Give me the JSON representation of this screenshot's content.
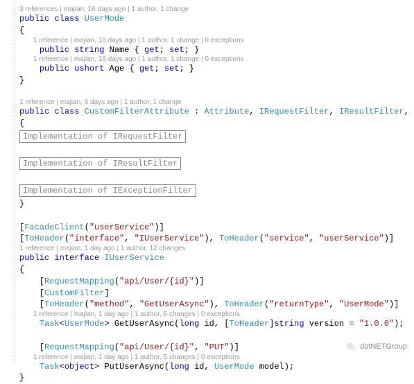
{
  "codelens": {
    "userMode": "3 references | majian, 16 days ago | 1 author, 1 change",
    "name": "1 reference | majian, 16 days ago | 1 author, 1 change | 0 exceptions",
    "age": "1 reference | majian, 16 days ago | 1 author, 1 change | 0 exceptions",
    "customFilter": "1 reference | majian, 6 days ago | 1 author, 1 change",
    "iuserService": "1 reference | majian, 1 day ago | 1 author, 12 changes",
    "getUser": "1 reference | majian, 1 day ago | 1 author, 6 changes | 0 exceptions",
    "putUser": "1 reference | majian, 1 day ago | 1 author, 5 changes | 0 exceptions"
  },
  "code": {
    "public": "public",
    "class": "class",
    "string_kw": "string",
    "ushort": "ushort",
    "interface": "interface",
    "long": "long",
    "get": "get",
    "set": "set",
    "object": "object",
    "UserMode": "UserMode",
    "Name": "Name",
    "Age": "Age",
    "CustomFilterAttribute": "CustomFilterAttribute",
    "Attribute": "Attribute",
    "IRequestFilter": "IRequestFilter",
    "IResultFilter": "IResultFilter",
    "IExceptionFilter": "IExceptionFilter",
    "FacadeClient": "FacadeClient",
    "ToHeader": "ToHeader",
    "RequestMapping": "RequestMapping",
    "CustomFilter": "CustomFilter",
    "IUserService": "IUserService",
    "Task": "Task",
    "GetUserAsync": "GetUserAsync",
    "PutUserAsync": "PutUserAsync"
  },
  "strings": {
    "userService": "\"userService\"",
    "interface": "\"interface\"",
    "IUserService": "\"IUserService\"",
    "service": "\"service\"",
    "apiUserId": "\"api/User/{id}\"",
    "method": "\"method\"",
    "GetUserAsync": "\"GetUserAsync\"",
    "returnType": "\"returnType\"",
    "UserMode": "\"UserMode\"",
    "v100": "\"1.0.0\"",
    "PUT": "\"PUT\""
  },
  "collapsed": {
    "req": "Implementation of IRequestFilter",
    "res": "Implementation of IResultFilter",
    "exc": "Implementation of IExceptionFilter"
  },
  "watermark": "dotNETGroup"
}
